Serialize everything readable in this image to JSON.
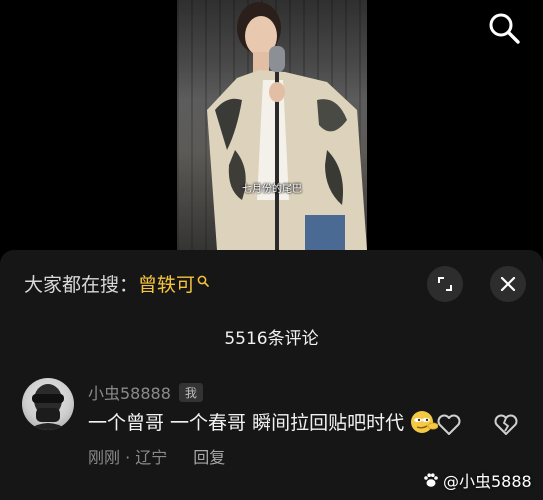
{
  "video": {
    "caption": "七月份的尾巴",
    "search_icon": "search-icon"
  },
  "sheet": {
    "search_prefix": "大家都在搜：",
    "search_keyword": "曾轶可",
    "expand_icon": "expand-icon",
    "close_icon": "close-icon",
    "comment_count_title": "5516条评论"
  },
  "comments": [
    {
      "username": "小虫58888",
      "author_tag": "我",
      "text": "一个曾哥 一个春哥  瞬间拉回贴吧时代",
      "emoji": "smirk-emoji",
      "time_location": "刚刚 · 辽宁",
      "reply_label": "回复"
    }
  ],
  "watermark": {
    "text": "@小虫5888",
    "icon": "paw-icon"
  },
  "colors": {
    "sheet_bg": "#161616",
    "keyword": "#f4c43c",
    "muted_text": "#8a8a8a"
  }
}
